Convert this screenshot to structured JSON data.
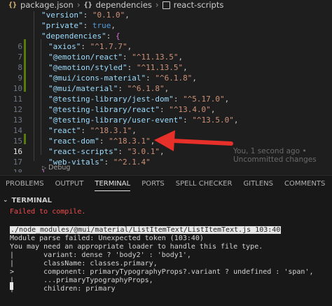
{
  "breadcrumb": {
    "file_icon": "{}",
    "file": "package.json",
    "sep": "›",
    "section_icon": "{}",
    "section": "dependencies",
    "item": "react-scripts"
  },
  "editor": {
    "lines": [
      {
        "num": "",
        "key": "\"version\"",
        "colon": ": ",
        "value": "\"0.1.0\"",
        "end": ","
      },
      {
        "num": "",
        "key": "\"private\"",
        "colon": ": ",
        "value": "true",
        "end": ","
      },
      {
        "num": "",
        "key": "\"dependencies\"",
        "colon": ": ",
        "value": "{",
        "end": ""
      },
      {
        "num": "6",
        "key": "\"axios\"",
        "colon": ": ",
        "value": "\"^1.7.7\"",
        "end": ","
      },
      {
        "num": "7",
        "key": "\"@emotion/react\"",
        "colon": ": ",
        "value": "\"^11.13.5\"",
        "end": ","
      },
      {
        "num": "8",
        "key": "\"@emotion/styled\"",
        "colon": ": ",
        "value": "\"^11.13.5\"",
        "end": ","
      },
      {
        "num": "9",
        "key": "\"@mui/icons-material\"",
        "colon": ": ",
        "value": "\"^6.1.8\"",
        "end": ","
      },
      {
        "num": "10",
        "key": "\"@mui/material\"",
        "colon": ": ",
        "value": "\"^6.1.8\"",
        "end": ","
      },
      {
        "num": "11",
        "key": "\"@testing-library/jest-dom\"",
        "colon": ": ",
        "value": "\"^5.17.0\"",
        "end": ","
      },
      {
        "num": "12",
        "key": "\"@testing-library/react\"",
        "colon": ": ",
        "value": "\"^13.4.0\"",
        "end": ","
      },
      {
        "num": "13",
        "key": "\"@testing-library/user-event\"",
        "colon": ": ",
        "value": "\"^13.5.0\"",
        "end": ","
      },
      {
        "num": "14",
        "key": "\"react\"",
        "colon": ": ",
        "value": "\"^18.3.1\"",
        "end": ","
      },
      {
        "num": "15",
        "key": "\"react-dom\"",
        "colon": ": ",
        "value": "\"^18.3.1\"",
        "end": ","
      },
      {
        "num": "16",
        "key": "\"react-scripts\"",
        "colon": ": ",
        "value": "\"3.0.1\"",
        "end": ","
      },
      {
        "num": "17",
        "key": "\"web-vitals\"",
        "colon": ": ",
        "value": "\"^2.1.4\"",
        "end": ""
      },
      {
        "num": "18",
        "key": "",
        "colon": "",
        "value": "},",
        "end": ""
      }
    ],
    "blame": "You, 1 second ago • Uncommitted changes",
    "debug_lens": "Debug",
    "active_line": "16"
  },
  "panel": {
    "tabs": [
      "PROBLEMS",
      "OUTPUT",
      "TERMINAL",
      "PORTS",
      "SPELL CHECKER",
      "GITLENS",
      "COMMENTS"
    ],
    "active_tab": "TERMINAL",
    "terminal_header": "TERMINAL",
    "terminal_lines": [
      {
        "text": "Failed to compile.",
        "style": "error"
      },
      {
        "text": "",
        "style": ""
      },
      {
        "text": "./node_modules/@mui/material/ListItemText/ListItemText.js 103:40",
        "style": "path"
      },
      {
        "text": "Module parse failed: Unexpected token (103:40)",
        "style": ""
      },
      {
        "text": "You may need an appropriate loader to handle this file type.",
        "style": ""
      },
      {
        "text": "|       variant: dense ? 'body2' : 'body1',",
        "style": ""
      },
      {
        "text": "|       className: classes.primary,",
        "style": ""
      },
      {
        "text": ">       component: primaryTypographyProps?.variant ? undefined : 'span',",
        "style": ""
      },
      {
        "text": "|       ...primaryTypographyProps,",
        "style": ""
      },
      {
        "text": "|       children: primary",
        "style": ""
      }
    ]
  },
  "colors": {
    "arrow": "#e8302a",
    "git_added": "#587c0c",
    "error": "#f14c4c"
  }
}
